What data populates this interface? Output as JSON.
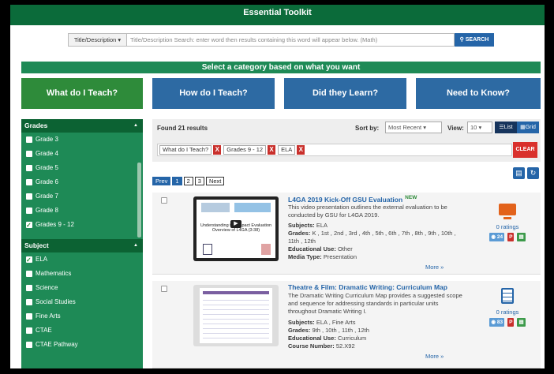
{
  "header": {
    "title": "Essential Toolkit"
  },
  "search": {
    "mode": "Title/Description ▾",
    "placeholder": "Title/Description Search:  enter word then results containing this word will appear below. (Math)",
    "button": "SEARCH"
  },
  "category_banner": "Select a category based on what you want",
  "categories": [
    {
      "label": "What do I Teach?"
    },
    {
      "label": "How do I Teach?"
    },
    {
      "label": "Did they Learn?"
    },
    {
      "label": "Need to Know?"
    }
  ],
  "sidebar": {
    "grades_title": "Grades",
    "grades": [
      {
        "label": "Grade 3",
        "checked": false
      },
      {
        "label": "Grade 4",
        "checked": false
      },
      {
        "label": "Grade 5",
        "checked": false
      },
      {
        "label": "Grade 6",
        "checked": false
      },
      {
        "label": "Grade 7",
        "checked": false
      },
      {
        "label": "Grade 8",
        "checked": false
      },
      {
        "label": "Grades 9 - 12",
        "checked": true
      }
    ],
    "subject_title": "Subject",
    "subjects": [
      {
        "label": "ELA",
        "checked": true
      },
      {
        "label": "Mathematics",
        "checked": false
      },
      {
        "label": "Science",
        "checked": false
      },
      {
        "label": "Social Studies",
        "checked": false
      },
      {
        "label": "Fine Arts",
        "checked": false
      },
      {
        "label": "CTAE",
        "checked": false
      },
      {
        "label": "CTAE Pathway",
        "checked": false
      }
    ]
  },
  "results": {
    "found": "Found 21 results",
    "sort_label": "Sort by:",
    "sort_value": "Most Recent",
    "view_label": "View:",
    "view_value": "10",
    "list_label": "List",
    "grid_label": "Grid",
    "chips": [
      "What do I Teach?",
      "Grades 9 - 12",
      "ELA"
    ],
    "chip_remove": "X",
    "clear_label": "CLEAR"
  },
  "pager": {
    "prev": "Prev",
    "pages": [
      "1",
      "2",
      "3"
    ],
    "next": "Next"
  },
  "items": [
    {
      "title": "L4GA 2019 Kick-Off GSU Evaluation",
      "badge_new": "NEW",
      "description": "This video presentation outlines the external evaluation to be conducted by GSU for L4GA 2019.",
      "subjects_label": "Subjects:",
      "subjects": "ELA",
      "grades_label": "Grades:",
      "grades": "K , 1st , 2nd , 3rd , 4th , 5th , 6th , 7th , 8th , 9th , 10th , 11th , 12th",
      "use_label": "Educational Use:",
      "use": "Other",
      "media_label": "Media Type:",
      "media": "Presentation",
      "more": "More »",
      "ratings": "0 ratings",
      "count": "24",
      "thumb_caption": "Understanding the Impact Evaluation Overview of L4GA (3:38)",
      "icon": "monitor-icon"
    },
    {
      "title": "Theatre & Film: Dramatic Writing: Curriculum Map",
      "description": "The Dramatic Writing Curriculum Map provides a suggested scope and sequence for addressing standards in particular units throughout Dramatic Writing I.",
      "subjects_label": "Subjects:",
      "subjects": "ELA , Fine Arts",
      "grades_label": "Grades:",
      "grades": "9th , 10th , 11th , 12th",
      "use_label": "Educational Use:",
      "use": "Curriculum",
      "course_label": "Course Number:",
      "course": "52.X92",
      "more": "More »",
      "ratings": "0 ratings",
      "count": "83",
      "icon": "document-icon"
    }
  ],
  "colors": {
    "dark_green": "#0b6b3a",
    "green": "#1e8a56",
    "blue": "#2d6aa3",
    "red": "#c9302c"
  }
}
